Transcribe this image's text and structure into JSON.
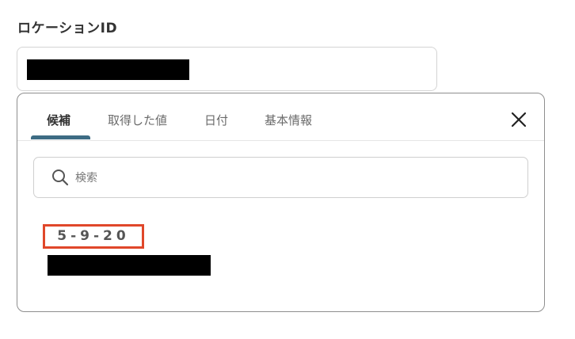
{
  "field": {
    "label": "ロケーションID"
  },
  "panel": {
    "tabs": [
      {
        "label": "候補",
        "active": true
      },
      {
        "label": "取得した値",
        "active": false
      },
      {
        "label": "日付",
        "active": false
      },
      {
        "label": "基本情報",
        "active": false
      }
    ],
    "close_icon": "close-icon",
    "search": {
      "placeholder": "検索",
      "value": "",
      "icon": "search-icon"
    },
    "suggestions": [
      {
        "value": "5-9-20"
      }
    ]
  },
  "colors": {
    "accent": "#3d6c84",
    "highlight_border": "#e0472a",
    "panel_border": "#8e8e8e"
  }
}
